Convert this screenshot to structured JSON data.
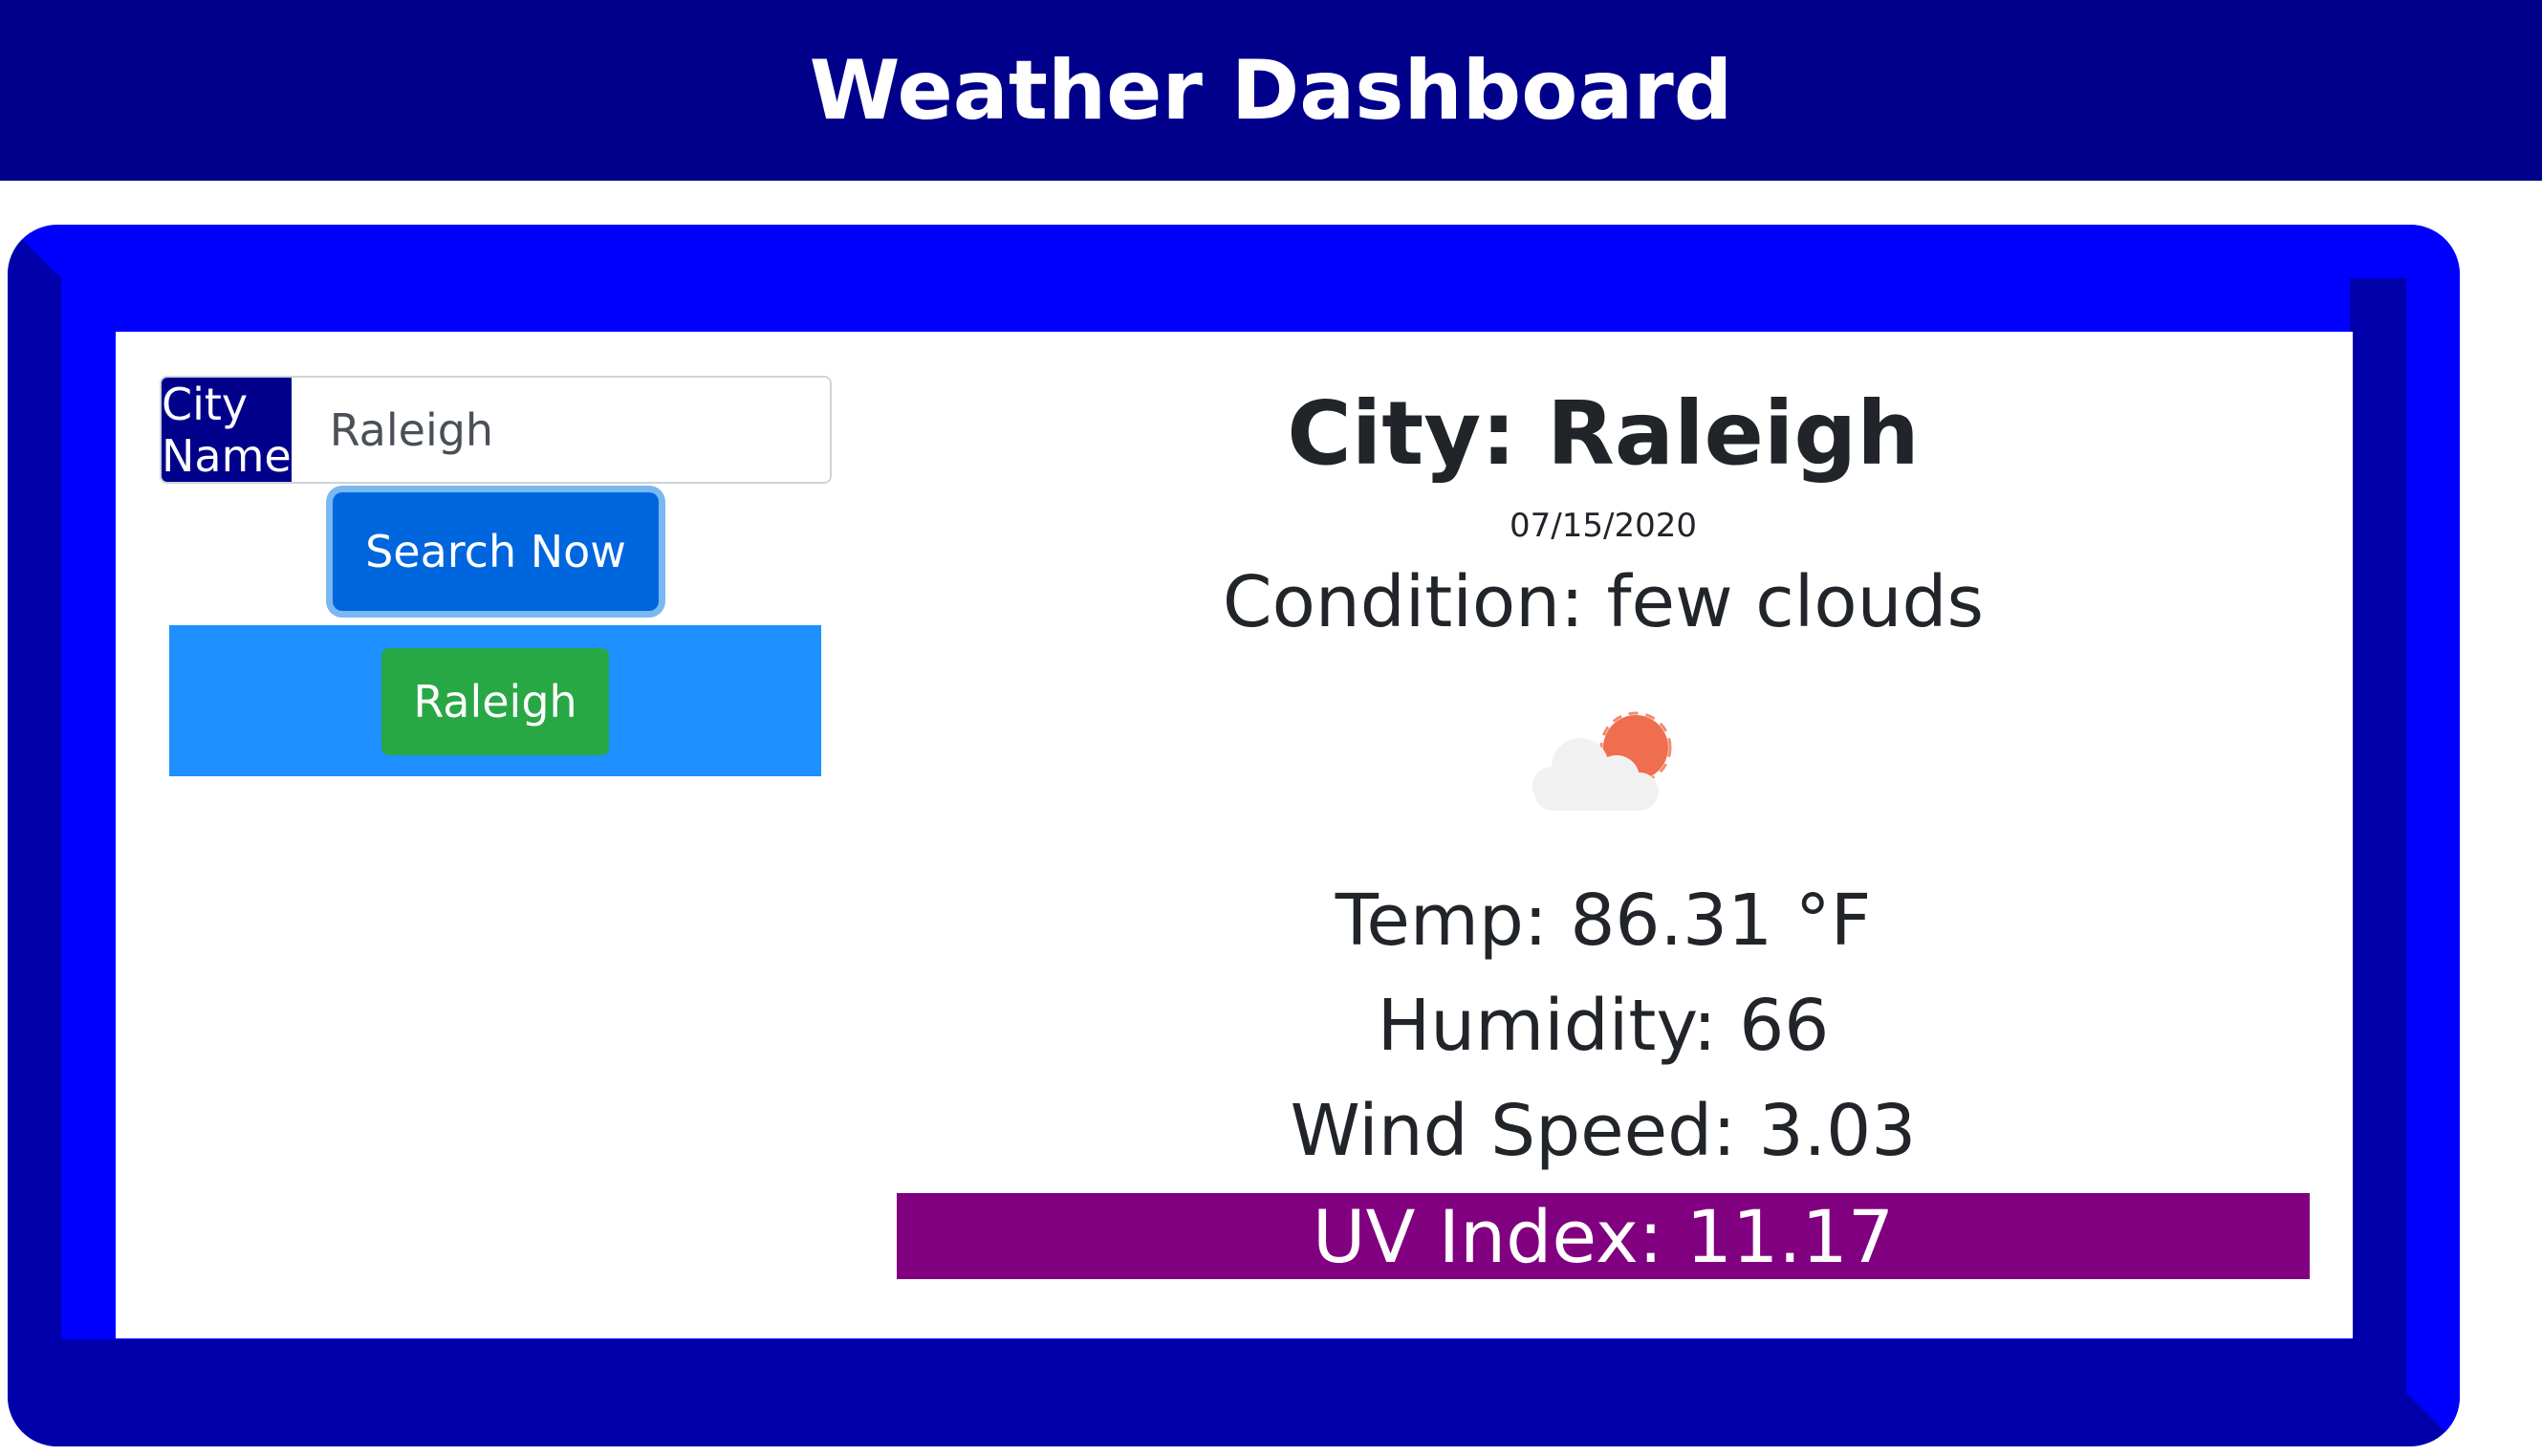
{
  "header": {
    "title": "Weather Dashboard",
    "bg_color": "#00008b"
  },
  "search": {
    "label": "City Name",
    "value": "Raleigh",
    "button_label": "Search Now"
  },
  "history": {
    "items": [
      "Raleigh"
    ]
  },
  "results": {
    "city": "City: Raleigh",
    "date": "07/15/2020",
    "condition": "Condition: few clouds",
    "icon": "few-clouds-icon",
    "temp": "Temp: 86.31 °F",
    "humidity": "Humidity: 66",
    "wind": "Wind Speed: 3.03",
    "uv": "UV Index: 11.17",
    "uv_color": "#800080"
  }
}
